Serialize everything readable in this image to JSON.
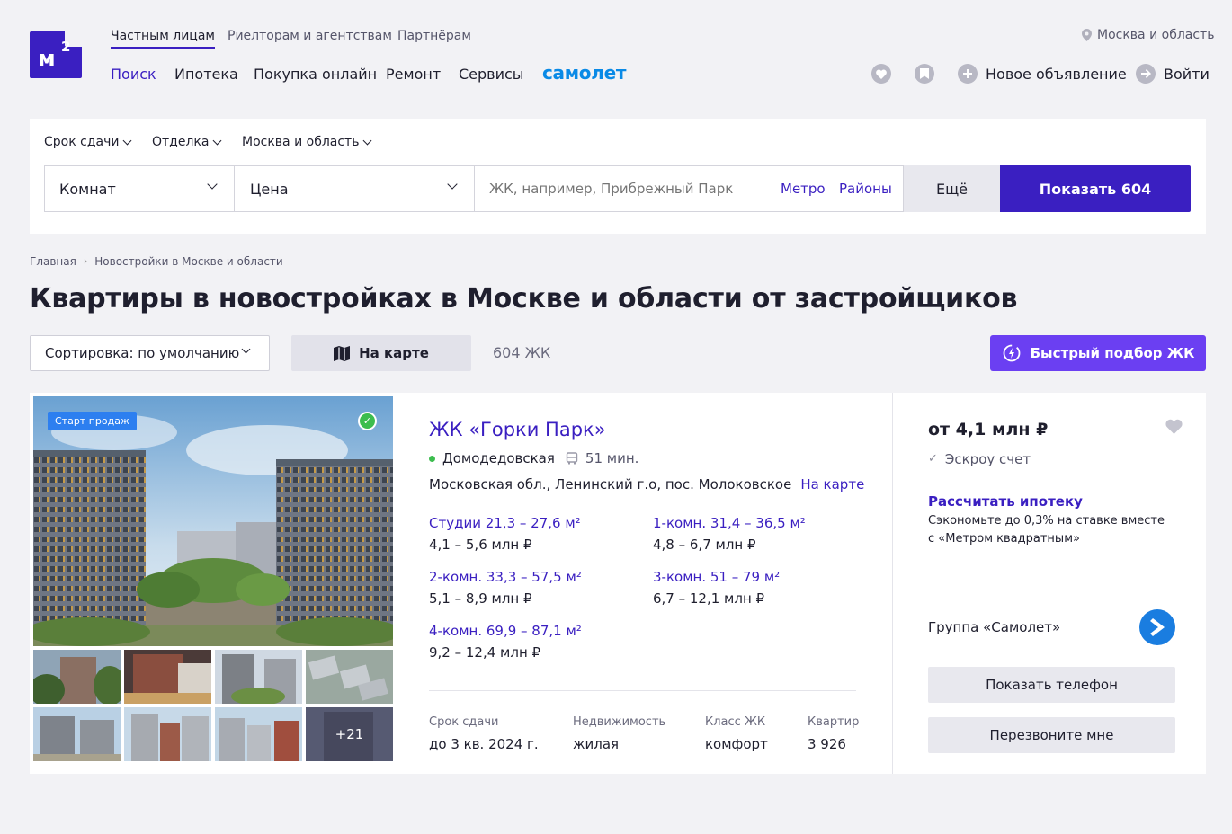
{
  "header": {
    "logo_m": "м",
    "logo_sup": "2",
    "top_links": [
      "Частным лицам",
      "Риелторам и агентствам",
      "Партнёрам"
    ],
    "nav": [
      "Поиск",
      "Ипотека",
      "Покупка онлайн",
      "Ремонт",
      "Сервисы"
    ],
    "samolet": "самолет",
    "region": "Москва и область",
    "new_ad": "Новое объявление",
    "login": "Войти"
  },
  "search": {
    "filters": [
      "Срок сдачи",
      "Отделка",
      "Москва и область"
    ],
    "rooms": "Комнат",
    "price": "Цена",
    "query_placeholder": "ЖК, например, Прибрежный Парк",
    "metro": "Метро",
    "districts": "Районы",
    "more": "Ещё",
    "show": "Показать 604"
  },
  "breadcrumbs": [
    "Главная",
    "Новостройки в Москве и области"
  ],
  "page_title": "Квартиры в новостройках в Москве и области от застройщиков",
  "toolbar": {
    "sort": "Сортировка: по умолчанию",
    "map": "На карте",
    "count": "604 ЖК",
    "quick": "Быстрый подбор ЖК"
  },
  "listing": {
    "badge": "Старт продаж",
    "more_photos": "+21",
    "title": "ЖК «Горки Парк»",
    "metro": "Домодедовская",
    "transit": "51 мин.",
    "address": "Московская обл., Ленинский г.о, пос. Молоковское",
    "on_map": "На карте",
    "apartments": [
      {
        "name": "Студии 21,3 – 27,6 м²",
        "price": "4,1 – 5,6 млн ₽"
      },
      {
        "name": "1-комн. 31,4 – 36,5 м²",
        "price": "4,8 – 6,7 млн ₽"
      },
      {
        "name": "2-комн. 33,3 – 57,5 м²",
        "price": "5,1 – 8,9 млн ₽"
      },
      {
        "name": "3-комн. 51 – 79 м²",
        "price": "6,7 – 12,1 млн ₽"
      },
      {
        "name": "4-комн. 69,9 – 87,1 м²",
        "price": "9,2 – 12,4 млн ₽"
      }
    ],
    "meta": [
      {
        "label": "Срок сдачи",
        "value": "до 3 кв. 2024 г."
      },
      {
        "label": "Недвижимость",
        "value": "жилая"
      },
      {
        "label": "Класс ЖК",
        "value": "комфорт"
      },
      {
        "label": "Квартир",
        "value": "3 926"
      }
    ],
    "price": "от 4,1 млн ₽",
    "escrow": "Эскроу счет",
    "mortgage": "Рассчитать ипотеку",
    "mortgage_sub": "Сэкономьте до 0,3% на ставке вместе с «Метром квадратным»",
    "developer": "Группа «Самолет»",
    "show_phone": "Показать телефон",
    "callback": "Перезвоните мне"
  },
  "colors": {
    "brand": "#3a1fc1",
    "accent": "#6b3ff2",
    "samolet": "#0a8ae6",
    "metro_line": "#3cbd4e"
  }
}
